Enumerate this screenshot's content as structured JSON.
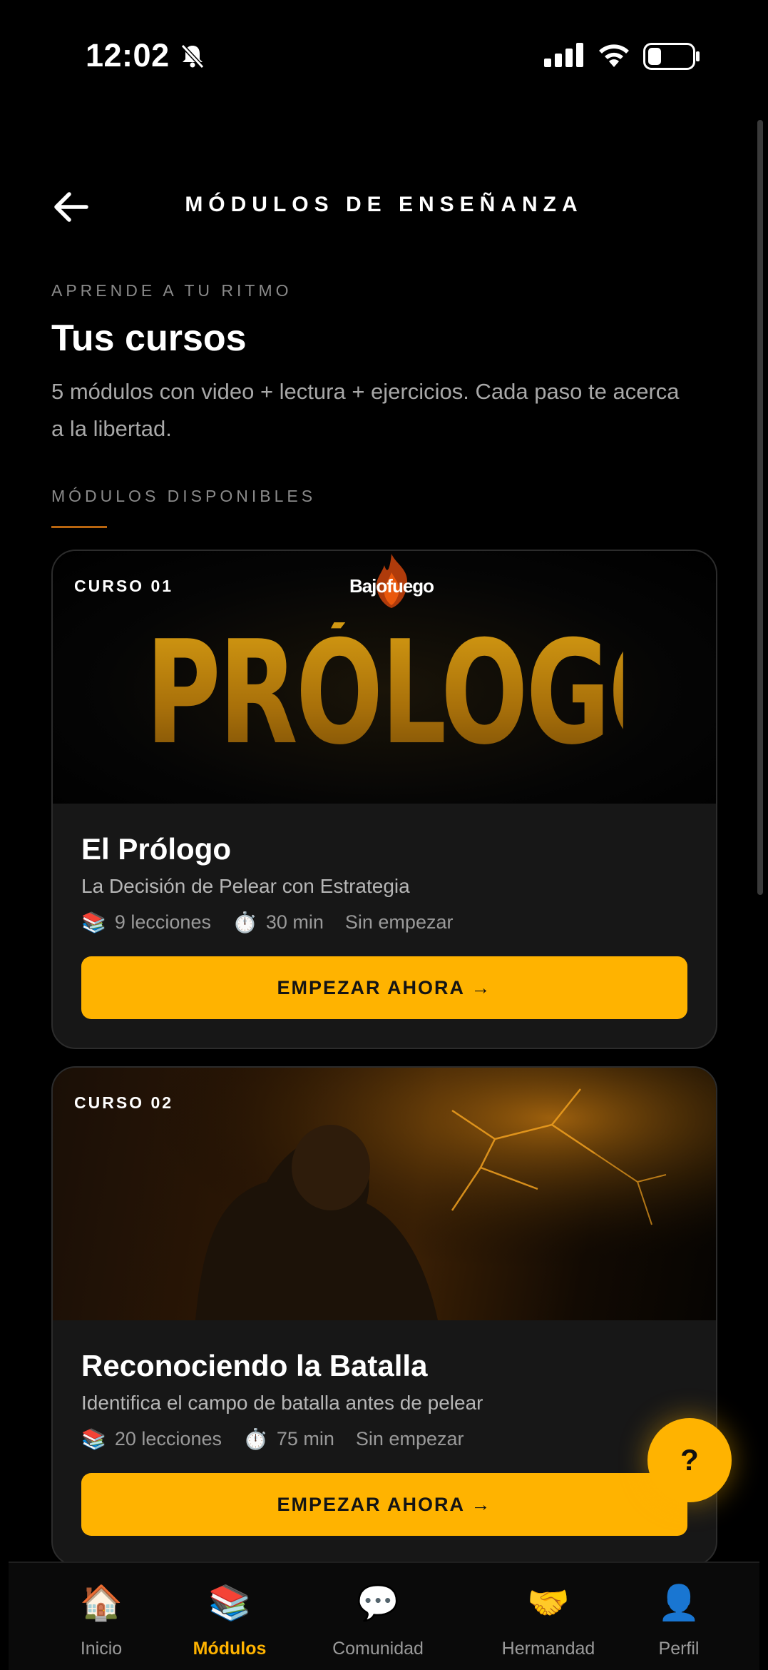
{
  "status_bar": {
    "time": "12:02"
  },
  "header": {
    "title": "MÓDULOS DE ENSEÑANZA"
  },
  "intro": {
    "eyebrow": "APRENDE A TU RITMO",
    "heading": "Tus cursos",
    "description": "5 módulos con video + lectura + ejercicios. Cada paso te acerca a la libertad."
  },
  "available_label": "MÓDULOS DISPONIBLES",
  "courses": [
    {
      "number": "CURSO 01",
      "brand": "Bajofuego",
      "art_text": "PRÓLOGO",
      "title": "El Prólogo",
      "subtitle": "La Decisión de Pelear con Estrategia",
      "lessons": "9 lecciones",
      "duration": "30 min",
      "status": "Sin empezar",
      "cta": "EMPEZAR AHORA →"
    },
    {
      "number": "CURSO 02",
      "title": "Reconociendo la Batalla",
      "subtitle": "Identifica el campo de batalla antes de pelear",
      "lessons": "20 lecciones",
      "duration": "75 min",
      "status": "Sin empezar",
      "cta": "EMPEZAR AHORA →"
    }
  ],
  "help_button": "?",
  "nav": {
    "items": [
      {
        "label": "Inicio",
        "icon": "🏠"
      },
      {
        "label": "Módulos",
        "icon": "📚"
      },
      {
        "label": "Comunidad",
        "icon": "💬"
      },
      {
        "label": "Hermandad",
        "icon": "🤝"
      },
      {
        "label": "Perfil",
        "icon": "👤"
      }
    ],
    "active": "Módulos"
  },
  "colors": {
    "accent": "#ffb300",
    "background": "#000000",
    "card": "#171717"
  }
}
